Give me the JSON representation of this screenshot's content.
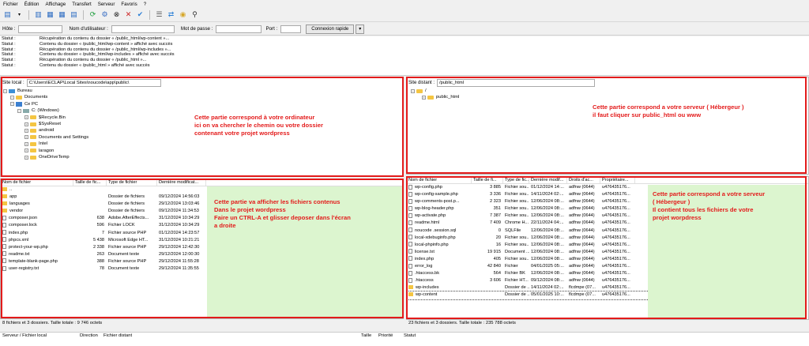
{
  "menu": [
    "Fichier",
    "Édition",
    "Affichage",
    "Transfert",
    "Serveur",
    "Favoris",
    "?"
  ],
  "quickconnect": {
    "host_label": "Hôte :",
    "user_label": "Nom d'utilisateur :",
    "pass_label": "Mot de passe :",
    "port_label": "Port :",
    "button": "Connexion rapide"
  },
  "log": [
    {
      "k": "Statut :",
      "v": "Récupération du contenu du dossier « /public_html/wp-content »..."
    },
    {
      "k": "Statut :",
      "v": "Contenu du dossier « /public_html/wp-content » affiché avec succès"
    },
    {
      "k": "Statut :",
      "v": "Récupération du contenu du dossier « /public_html/wp-includes »..."
    },
    {
      "k": "Statut :",
      "v": "Contenu du dossier « /public_html/wp-includes » affiché avec succès"
    },
    {
      "k": "Statut :",
      "v": "Récupération du contenu du dossier « /public_html »..."
    },
    {
      "k": "Statut :",
      "v": "Contenu du dossier « /public_html » affiché avec succès"
    }
  ],
  "local": {
    "label": "Site local :",
    "path": "C:\\Users\\ECLAP\\Local Sites\\noucode\\app\\public\\",
    "tree": [
      {
        "name": "Bureau",
        "indent": 0,
        "icon": "desktop"
      },
      {
        "name": "Documents",
        "indent": 1,
        "icon": "folder"
      },
      {
        "name": "Ce PC",
        "indent": 1,
        "icon": "pc"
      },
      {
        "name": "C: (Windows)",
        "indent": 2,
        "icon": "drive"
      },
      {
        "name": "$Recycle.Bin",
        "indent": 3,
        "icon": "folder"
      },
      {
        "name": "$SysReset",
        "indent": 3,
        "icon": "folder"
      },
      {
        "name": "android",
        "indent": 3,
        "icon": "folder"
      },
      {
        "name": "Documents and Settings",
        "indent": 3,
        "icon": "folder"
      },
      {
        "name": "Intel",
        "indent": 3,
        "icon": "folder"
      },
      {
        "name": "laragon",
        "indent": 3,
        "icon": "folder"
      },
      {
        "name": "OneDriveTemp",
        "indent": 3,
        "icon": "folder"
      }
    ],
    "annot_tree": "Cette partie correspond à votre ordinateur\nici on va chercher le chemin ou votre dossier\ncontenant votre projet wordpress",
    "cols": [
      "Nom de fichier",
      "Taille de fic...",
      "Type de fichier",
      "Dernière modificat..."
    ],
    "files": [
      {
        "n": "..",
        "s": "",
        "t": "",
        "d": "",
        "folder": true
      },
      {
        "n": "app",
        "s": "",
        "t": "Dossier de fichiers",
        "d": "09/12/2024 14:56:03",
        "folder": true
      },
      {
        "n": "languages",
        "s": "",
        "t": "Dossier de fichiers",
        "d": "29/12/2024 13:03:46",
        "folder": true
      },
      {
        "n": "vendor",
        "s": "",
        "t": "Dossier de fichiers",
        "d": "09/12/2024 11:34:53",
        "folder": true
      },
      {
        "n": "composer.json",
        "s": "638",
        "t": "Adobe.AfterEffects...",
        "d": "31/12/2024 10:34:29",
        "folder": false
      },
      {
        "n": "composer.lock",
        "s": "596",
        "t": "Fichier LOCK",
        "d": "31/12/2024 10:34:29",
        "folder": false
      },
      {
        "n": "index.php",
        "s": "7",
        "t": "Fichier source PHP",
        "d": "01/12/2024 14:23:57",
        "folder": false
      },
      {
        "n": "phpcs.xml",
        "s": "5 438",
        "t": "Microsoft Edge HT...",
        "d": "31/12/2024 10:21:21",
        "folder": false
      },
      {
        "n": "protect-your-wp.php",
        "s": "2 338",
        "t": "Fichier source PHP",
        "d": "29/12/2024 12:42:30",
        "folder": false
      },
      {
        "n": "readme.txt",
        "s": "263",
        "t": "Document texte",
        "d": "29/12/2024 12:00:30",
        "folder": false
      },
      {
        "n": "template-blank-page.php",
        "s": "388",
        "t": "Fichier source PHP",
        "d": "29/12/2024 11:55:28",
        "folder": false
      },
      {
        "n": "user-registry.txt",
        "s": "78",
        "t": "Document texte",
        "d": "29/12/2024 11:35:55",
        "folder": false
      }
    ],
    "annot_files": "Cette partie va afficher les fichiers contenus\nDans le projet wordpress\nFaire un CTRL-A et glisser deposer dans l'écran\na droite",
    "status": "8 fichiers et 3 dossiers. Taille totale : 9 746 octets"
  },
  "remote": {
    "label": "Site distant :",
    "path": "/public_html",
    "tree": [
      {
        "name": "/",
        "indent": 0
      },
      {
        "name": "public_html",
        "indent": 1
      }
    ],
    "annot_tree": "Cette partie correspond a votre serveur ( Hébergeur )\nil faut cliquer sur public_html ou www",
    "cols": [
      "Nom de fichier",
      "Taille de fi...",
      "Type de fic...",
      "Dernière modif...",
      "Droits d'ac...",
      "Propriétaire..."
    ],
    "files": [
      {
        "n": "wp-config.php",
        "s": "3 885",
        "t": "Fichier sou...",
        "d": "01/12/2024 14:...",
        "r": "adfnw (0644)",
        "o": "u476435176...",
        "folder": false
      },
      {
        "n": "wp-config-sample.php",
        "s": "3 336",
        "t": "Fichier sou...",
        "d": "14/11/2024 02:...",
        "r": "adfnw (0644)",
        "o": "u476435176...",
        "folder": false
      },
      {
        "n": "wp-comments-post.p...",
        "s": "2 323",
        "t": "Fichier sou...",
        "d": "12/06/2024 08:...",
        "r": "adfnw (0644)",
        "o": "u476435176...",
        "folder": false
      },
      {
        "n": "wp-blog-header.php",
        "s": "351",
        "t": "Fichier sou...",
        "d": "12/06/2024 08:...",
        "r": "adfnw (0644)",
        "o": "u476435176...",
        "folder": false
      },
      {
        "n": "wp-activate.php",
        "s": "7 387",
        "t": "Fichier sou...",
        "d": "12/06/2024 08:...",
        "r": "adfnw (0644)",
        "o": "u476435176...",
        "folder": false
      },
      {
        "n": "readme.html",
        "s": "7 409",
        "t": "Chrome H...",
        "d": "22/11/2024 04:...",
        "r": "adfnw (0644)",
        "o": "u476435176...",
        "folder": false
      },
      {
        "n": "noucode .session.sql",
        "s": "0",
        "t": "SQLFile",
        "d": "12/06/2024 08:...",
        "r": "adfnw (0644)",
        "o": "u476435176...",
        "folder": false
      },
      {
        "n": "local-xdebuginfo.php",
        "s": "20",
        "t": "Fichier sou...",
        "d": "12/06/2024 08:...",
        "r": "adfnw (0644)",
        "o": "u476435176...",
        "folder": false
      },
      {
        "n": "local-phpinfo.php",
        "s": "16",
        "t": "Fichier sou...",
        "d": "12/06/2024 08:...",
        "r": "adfnw (0644)",
        "o": "u476435176...",
        "folder": false
      },
      {
        "n": "license.txt",
        "s": "19 915",
        "t": "Document ...",
        "d": "12/06/2024 08:...",
        "r": "adfnw (0644)",
        "o": "u476435176...",
        "folder": false
      },
      {
        "n": "index.php",
        "s": "405",
        "t": "Fichier sou...",
        "d": "12/06/2024 08:...",
        "r": "adfnw (0644)",
        "o": "u476435176...",
        "folder": false
      },
      {
        "n": "error_log",
        "s": "42 840",
        "t": "Fichier",
        "d": "04/01/2025 05:...",
        "r": "adfnw (0644)",
        "o": "u476435176...",
        "folder": false
      },
      {
        "n": ".htaccess.bk",
        "s": "564",
        "t": "Fichier BK",
        "d": "12/06/2024 08:...",
        "r": "adfnw (0644)",
        "o": "u476435176...",
        "folder": false
      },
      {
        "n": ".htaccess",
        "s": "3 606",
        "t": "Fichier HT...",
        "d": "09/12/2024 08:...",
        "r": "adfnw (0644)",
        "o": "u476435176...",
        "folder": false
      },
      {
        "n": "wp-includes",
        "s": "",
        "t": "Dossier de ...",
        "d": "14/11/2024 02:...",
        "r": "flcdmpe (07...",
        "o": "u476435176...",
        "folder": true
      },
      {
        "n": "wp-content",
        "s": "",
        "t": "Dossier de ...",
        "d": "05/01/2025 10:...",
        "r": "flcdmpe (07...",
        "o": "u476435176...",
        "folder": true
      }
    ],
    "annot_files": "Cette partie correspond a votre serveur\n( Hébergeur )\nIl contient tous les fichiers de votre\nprojet worpdress",
    "status": "23 fichiers et 3 dossiers. Taille totale : 235 788 octets"
  },
  "queue": {
    "cols": [
      "Serveur / Fichier local",
      "Direction",
      "Fichier distant",
      "Taille",
      "Priorité",
      "Statut"
    ]
  },
  "colors": {
    "annotation": "#e31b1b",
    "green": "#dcf5cf"
  }
}
